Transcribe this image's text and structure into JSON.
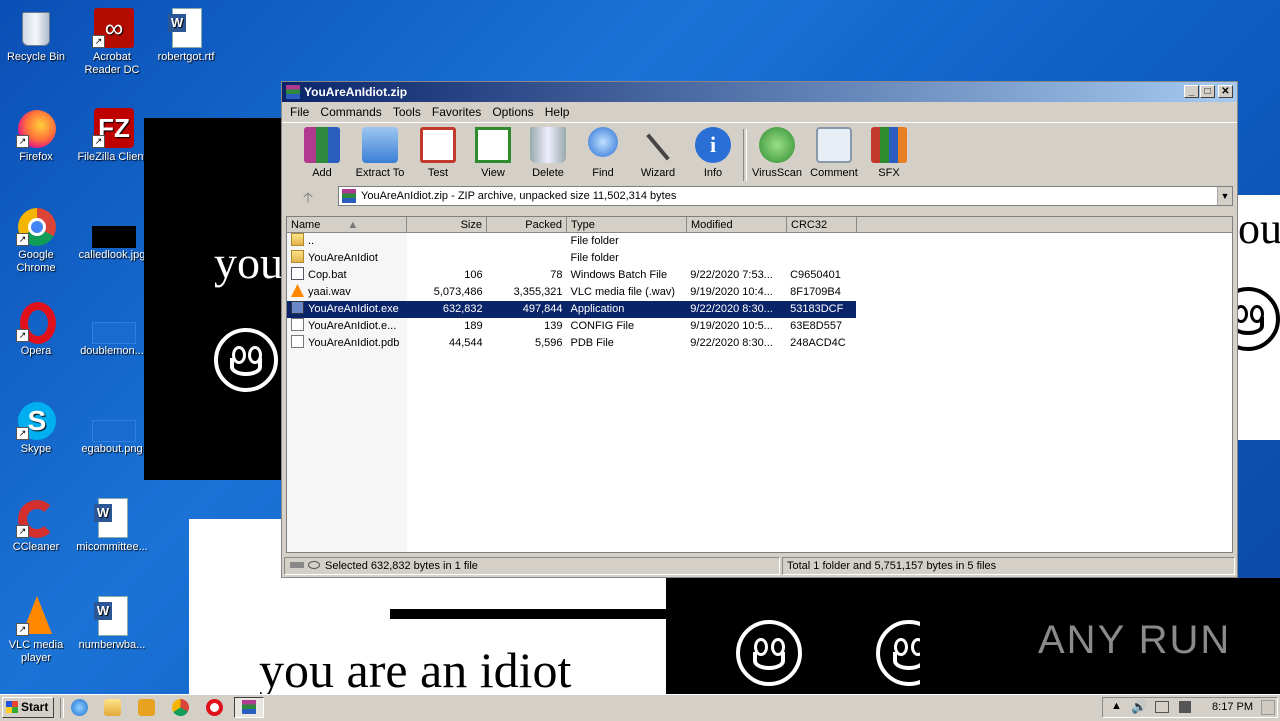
{
  "desktop": {
    "icons": [
      {
        "label": "Recycle Bin",
        "icon": "recycle-bin-icon"
      },
      {
        "label": "Acrobat Reader DC",
        "icon": "acrobat-icon"
      },
      {
        "label": "robertgot.rtf",
        "icon": "word-document-icon"
      },
      {
        "label": "Firefox",
        "icon": "firefox-icon"
      },
      {
        "label": "FileZilla Client",
        "icon": "filezilla-icon"
      },
      {
        "label": "Google Chrome",
        "icon": "chrome-icon"
      },
      {
        "label": "calledlook.jpg",
        "icon": "image-file-icon"
      },
      {
        "label": "Opera",
        "icon": "opera-icon"
      },
      {
        "label": "doublemon...",
        "icon": "image-file-icon"
      },
      {
        "label": "Skype",
        "icon": "skype-icon"
      },
      {
        "label": "egabout.png",
        "icon": "image-file-icon"
      },
      {
        "label": "CCleaner",
        "icon": "ccleaner-icon"
      },
      {
        "label": "micommittee...",
        "icon": "word-document-icon"
      },
      {
        "label": "VLC media player",
        "icon": "vlc-icon"
      },
      {
        "label": "numberwba...",
        "icon": "word-document-icon"
      }
    ]
  },
  "popups": {
    "text1": "you",
    "text2": "you are an idiot",
    "text3": "ou",
    "watermark": "ANY RUN"
  },
  "window": {
    "title": "YouAreAnIdiot.zip",
    "menu": [
      "File",
      "Commands",
      "Tools",
      "Favorites",
      "Options",
      "Help"
    ],
    "toolbar": [
      {
        "label": "Add",
        "icon": "add-archive-icon"
      },
      {
        "label": "Extract To",
        "icon": "extract-folder-icon"
      },
      {
        "label": "Test",
        "icon": "test-clipboard-icon"
      },
      {
        "label": "View",
        "icon": "view-book-icon"
      },
      {
        "label": "Delete",
        "icon": "trash-can-icon"
      },
      {
        "label": "Find",
        "icon": "magnifier-icon"
      },
      {
        "label": "Wizard",
        "icon": "magic-wand-icon"
      },
      {
        "label": "Info",
        "icon": "info-icon"
      },
      {
        "label": "VirusScan",
        "icon": "virus-scan-icon"
      },
      {
        "label": "Comment",
        "icon": "comment-icon"
      },
      {
        "label": "SFX",
        "icon": "sfx-icon"
      }
    ],
    "address": "YouAreAnIdiot.zip - ZIP archive, unpacked size 11,502,314 bytes",
    "columns": [
      "Name",
      "Size",
      "Packed",
      "Type",
      "Modified",
      "CRC32"
    ],
    "files": [
      {
        "name": "..",
        "size": "",
        "packed": "",
        "type": "File folder",
        "modified": "",
        "crc": "",
        "icon": "folder-icon"
      },
      {
        "name": "YouAreAnIdiot",
        "size": "",
        "packed": "",
        "type": "File folder",
        "modified": "",
        "crc": "",
        "icon": "folder-icon"
      },
      {
        "name": "Cop.bat",
        "size": "106",
        "packed": "78",
        "type": "Windows Batch File",
        "modified": "9/22/2020 7:53...",
        "crc": "C9650401",
        "icon": "batch-file-icon"
      },
      {
        "name": "yaai.wav",
        "size": "5,073,486",
        "packed": "3,355,321",
        "type": "VLC media file (.wav)",
        "modified": "9/19/2020 10:4...",
        "crc": "8F1709B4",
        "icon": "vlc-file-icon"
      },
      {
        "name": "YouAreAnIdiot.exe",
        "size": "632,832",
        "packed": "497,844",
        "type": "Application",
        "modified": "9/22/2020 8:30...",
        "crc": "53183DCF",
        "icon": "exe-file-icon"
      },
      {
        "name": "YouAreAnIdiot.e...",
        "size": "189",
        "packed": "139",
        "type": "CONFIG File",
        "modified": "9/19/2020 10:5...",
        "crc": "63E8D557",
        "icon": "file-icon"
      },
      {
        "name": "YouAreAnIdiot.pdb",
        "size": "44,544",
        "packed": "5,596",
        "type": "PDB File",
        "modified": "9/22/2020 8:30...",
        "crc": "248ACD4C",
        "icon": "file-icon"
      }
    ],
    "status_left": "Selected 632,832 bytes in 1 file",
    "status_right": "Total 1 folder and 5,751,157 bytes in 5 files"
  },
  "taskbar": {
    "start": "Start",
    "clock": "8:17 PM"
  },
  "colors": {
    "selection": "#0a246a",
    "desktop": "#1565c8"
  }
}
